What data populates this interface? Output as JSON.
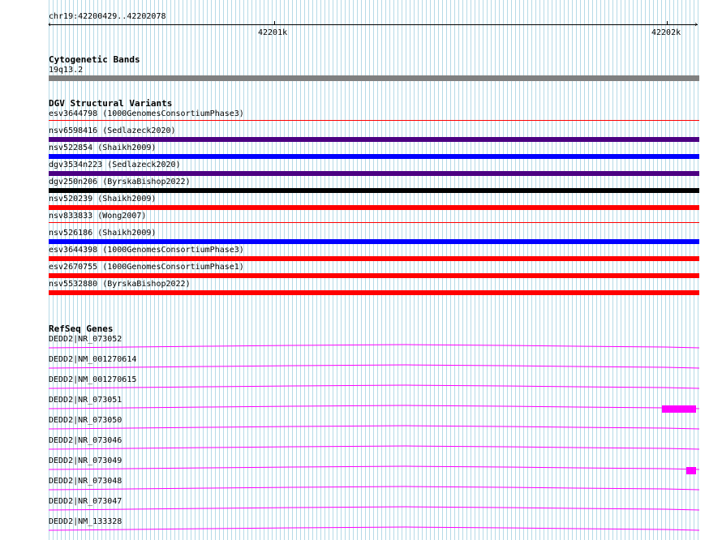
{
  "ruler": {
    "position": "chr19:42200429..42202078",
    "tick_labels": [
      "42201k",
      "42202k"
    ]
  },
  "cytoband": {
    "title": "Cytogenetic Bands",
    "band_label": "19q13.2",
    "band_color": "#808080"
  },
  "dgv": {
    "title": "DGV Structural Variants",
    "items": [
      {
        "label": "esv3644798 (1000GenomesConsortiumPhase3)",
        "color": "#ff0000",
        "thick": false
      },
      {
        "label": "nsv6598416 (Sedlazeck2020)",
        "color": "#4b0082",
        "thick": true
      },
      {
        "label": "nsv522854 (Shaikh2009)",
        "color": "#0000ff",
        "thick": true
      },
      {
        "label": "dgv3534n223 (Sedlazeck2020)",
        "color": "#4b0082",
        "thick": true
      },
      {
        "label": "dgv250n206 (ByrskaBishop2022)",
        "color": "#000000",
        "thick": true
      },
      {
        "label": "nsv520239 (Shaikh2009)",
        "color": "#ff0000",
        "thick": true
      },
      {
        "label": "nsv833833 (Wong2007)",
        "color": "#ff0000",
        "thick": false
      },
      {
        "label": "nsv526186 (Shaikh2009)",
        "color": "#0000ff",
        "thick": true
      },
      {
        "label": "esv3644398 (1000GenomesConsortiumPhase3)",
        "color": "#ff0000",
        "thick": true
      },
      {
        "label": "esv2670755 (1000GenomesConsortiumPhase1)",
        "color": "#ff0000",
        "thick": true
      },
      {
        "label": "nsv5532880 (ByrskaBishop2022)",
        "color": "#ff0000",
        "thick": true
      }
    ]
  },
  "refseq": {
    "title": "RefSeq Genes",
    "color": "#ff00ff",
    "genes": [
      {
        "label": "DEDD2|NR_073052"
      },
      {
        "label": "DEDD2|NM_001270614"
      },
      {
        "label": "DEDD2|NM_001270615"
      },
      {
        "label": "DEDD2|NR_073051"
      },
      {
        "label": "DEDD2|NR_073050"
      },
      {
        "label": "DEDD2|NR_073046"
      },
      {
        "label": "DEDD2|NR_073049"
      },
      {
        "label": "DEDD2|NR_073048"
      },
      {
        "label": "DEDD2|NR_073047"
      },
      {
        "label": "DEDD2|NM_133328"
      }
    ]
  }
}
